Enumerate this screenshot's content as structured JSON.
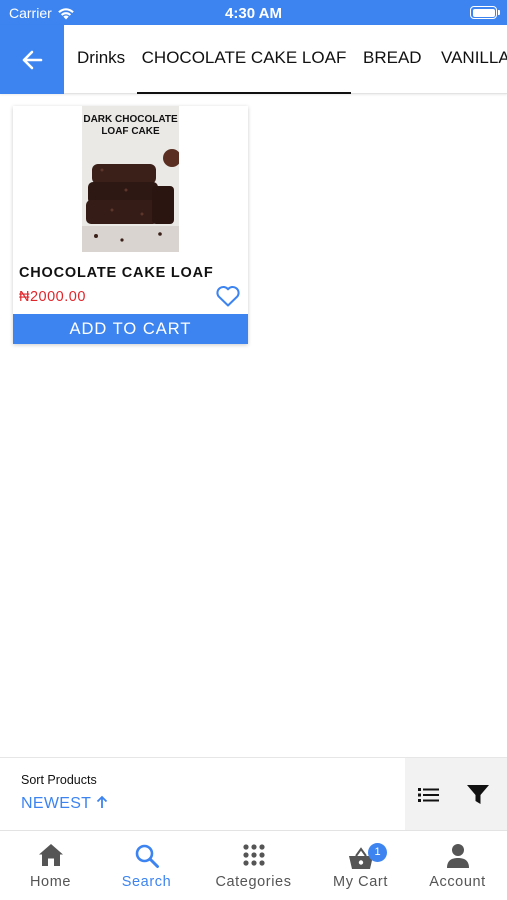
{
  "status_bar": {
    "carrier": "Carrier",
    "time": "4:30 AM"
  },
  "header": {
    "back_icon": "arrow-left-icon",
    "tabs": [
      {
        "label": "Drinks",
        "active": false
      },
      {
        "label": "CHOCOLATE CAKE LOAF",
        "active": true
      },
      {
        "label": "BREAD",
        "active": false
      },
      {
        "label": "VANILLA",
        "active": false
      }
    ]
  },
  "products": [
    {
      "image_title": "DARK CHOCOLATE LOAF CAKE",
      "name": "CHOCOLATE CAKE LOAF",
      "price": "₦2000.00",
      "favorite_icon": "heart-outline-icon",
      "add_to_cart_label": "ADD TO CART"
    }
  ],
  "sort": {
    "label": "Sort Products",
    "value": "NEWEST",
    "direction_icon": "arrow-up-icon"
  },
  "bottom_nav": {
    "items": [
      {
        "label": "Home",
        "icon": "home-icon",
        "active": false
      },
      {
        "label": "Search",
        "icon": "search-icon",
        "active": true
      },
      {
        "label": "Categories",
        "icon": "grid-icon",
        "active": false
      },
      {
        "label": "My Cart",
        "icon": "basket-icon",
        "active": false,
        "badge": "1"
      },
      {
        "label": "Account",
        "icon": "person-icon",
        "active": false
      }
    ]
  },
  "colors": {
    "accent": "#3d84f0",
    "price": "#e0262b"
  }
}
